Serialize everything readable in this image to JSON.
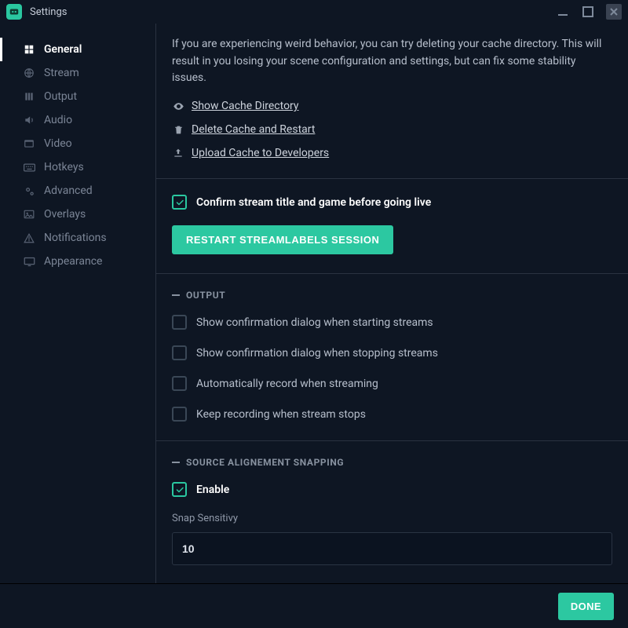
{
  "window": {
    "title": "Settings"
  },
  "sidebar": {
    "items": [
      {
        "label": "General",
        "icon": "grid"
      },
      {
        "label": "Stream",
        "icon": "globe"
      },
      {
        "label": "Output",
        "icon": "output"
      },
      {
        "label": "Audio",
        "icon": "audio"
      },
      {
        "label": "Video",
        "icon": "video"
      },
      {
        "label": "Hotkeys",
        "icon": "keyboard"
      },
      {
        "label": "Advanced",
        "icon": "cogs"
      },
      {
        "label": "Overlays",
        "icon": "image"
      },
      {
        "label": "Notifications",
        "icon": "warning"
      },
      {
        "label": "Appearance",
        "icon": "monitor"
      }
    ],
    "active_index": 0
  },
  "cache": {
    "description": "If you are experiencing weird behavior, you can try deleting your cache directory. This will result in you losing your scene configuration and settings, but can fix some stability issues.",
    "links": {
      "show": "Show Cache Directory",
      "delete": "Delete Cache and Restart",
      "upload": "Upload Cache to Developers"
    }
  },
  "confirm_live": {
    "label": "Confirm stream title and game before going live",
    "checked": true
  },
  "restart_button": "RESTART STREAMLABELS SESSION",
  "output_section": {
    "title": "OUTPUT",
    "options": [
      {
        "label": "Show confirmation dialog when starting streams",
        "checked": false
      },
      {
        "label": "Show confirmation dialog when stopping streams",
        "checked": false
      },
      {
        "label": "Automatically record when streaming",
        "checked": false
      },
      {
        "label": "Keep recording when stream stops",
        "checked": false
      }
    ]
  },
  "snapping_section": {
    "title": "SOURCE ALIGNEMENT SNAPPING",
    "enable": {
      "label": "Enable",
      "checked": true
    },
    "sensitivity": {
      "label": "Snap Sensitivy",
      "value": "10"
    }
  },
  "footer": {
    "done": "DONE"
  }
}
